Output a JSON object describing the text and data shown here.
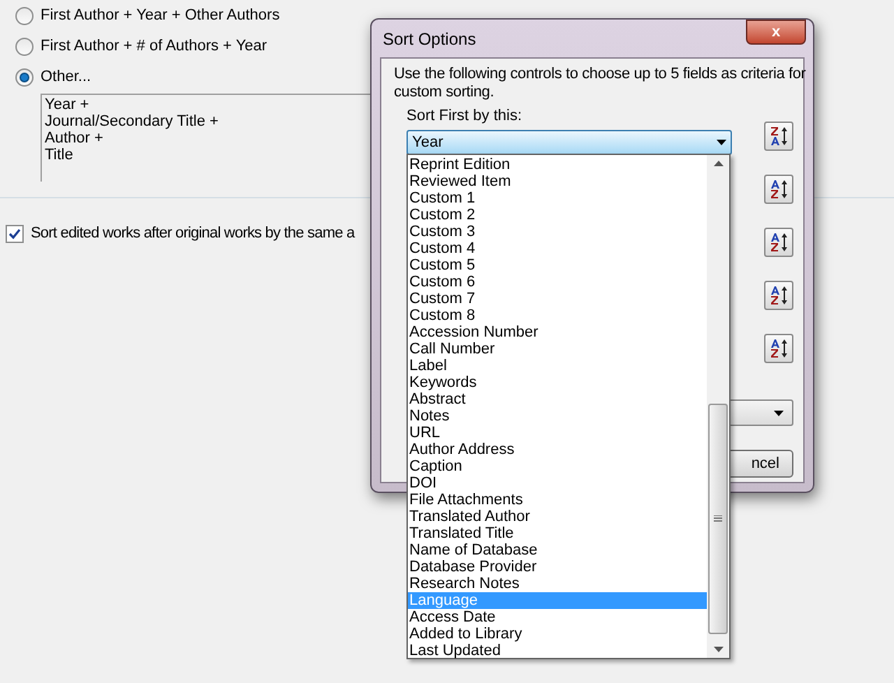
{
  "background": {
    "radios": [
      {
        "label": "First Author + Year + Other Authors",
        "selected": false
      },
      {
        "label": "First Author + # of Authors + Year",
        "selected": false
      },
      {
        "label": "Other...",
        "selected": true
      }
    ],
    "custom_order": [
      "Year +",
      "Journal/Secondary Title +",
      "Author +",
      "Title"
    ],
    "checkbox": {
      "label": "Sort edited works after original works by the same a",
      "checked": true
    }
  },
  "dialog": {
    "title": "Sort Options",
    "close": "x",
    "description": "Use the following controls to choose up to 5 fields as criteria for custom sorting.",
    "first_label": "Sort First by this:",
    "first_value": "Year",
    "order_buttons": [
      {
        "descending": true
      },
      {
        "descending": false
      },
      {
        "descending": false
      },
      {
        "descending": false
      },
      {
        "descending": false
      }
    ],
    "cancel_button": "ncel",
    "dropdown": [
      {
        "label": "Reprint Edition",
        "selected": false
      },
      {
        "label": "Reviewed Item",
        "selected": false
      },
      {
        "label": "Custom 1",
        "selected": false
      },
      {
        "label": "Custom 2",
        "selected": false
      },
      {
        "label": "Custom 3",
        "selected": false
      },
      {
        "label": "Custom 4",
        "selected": false
      },
      {
        "label": "Custom 5",
        "selected": false
      },
      {
        "label": "Custom 6",
        "selected": false
      },
      {
        "label": "Custom 7",
        "selected": false
      },
      {
        "label": "Custom 8",
        "selected": false
      },
      {
        "label": "Accession Number",
        "selected": false
      },
      {
        "label": "Call Number",
        "selected": false
      },
      {
        "label": "Label",
        "selected": false
      },
      {
        "label": "Keywords",
        "selected": false
      },
      {
        "label": "Abstract",
        "selected": false
      },
      {
        "label": "Notes",
        "selected": false
      },
      {
        "label": "URL",
        "selected": false
      },
      {
        "label": "Author Address",
        "selected": false
      },
      {
        "label": "Caption",
        "selected": false
      },
      {
        "label": "DOI",
        "selected": false
      },
      {
        "label": "File Attachments",
        "selected": false
      },
      {
        "label": "Translated Author",
        "selected": false
      },
      {
        "label": "Translated Title",
        "selected": false
      },
      {
        "label": "Name of Database",
        "selected": false
      },
      {
        "label": "Database Provider",
        "selected": false
      },
      {
        "label": "Research Notes",
        "selected": false
      },
      {
        "label": "Language",
        "selected": true
      },
      {
        "label": "Access Date",
        "selected": false
      },
      {
        "label": "Added to Library",
        "selected": false
      },
      {
        "label": "Last Updated",
        "selected": false
      }
    ]
  }
}
